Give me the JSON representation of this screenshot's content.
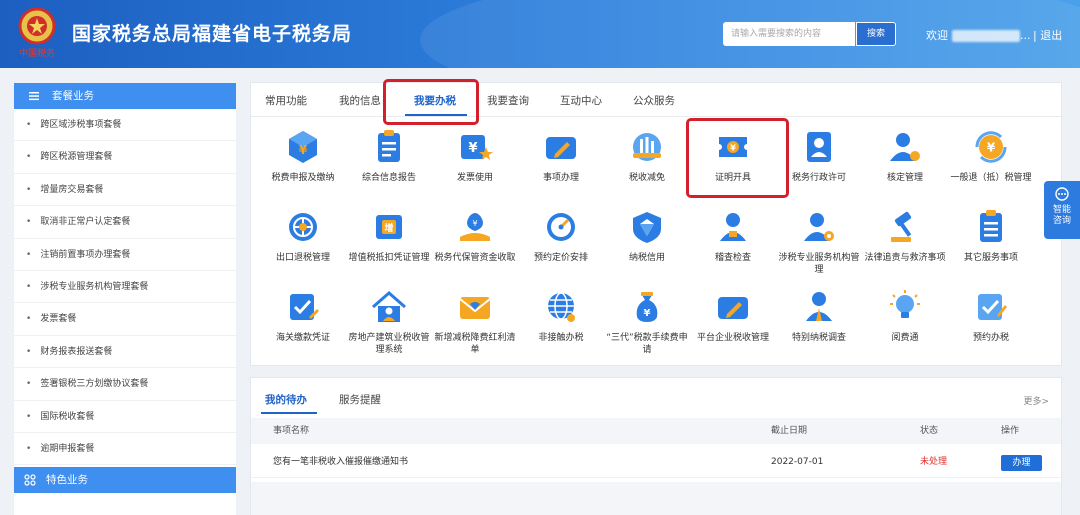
{
  "header": {
    "title": "国家税务总局福建省电子税务局",
    "emblem_text": "中国税务",
    "search_placeholder": "请输入需要搜索的内容",
    "search_button": "搜索",
    "welcome": "欢迎",
    "welcome_suffix": "...",
    "logout": "| 退出"
  },
  "sidebar": {
    "section1": "套餐业务",
    "items": [
      "跨区域涉税事项套餐",
      "跨区税源管理套餐",
      "增量房交易套餐",
      "取消非正常户认定套餐",
      "注销前置事项办理套餐",
      "涉税专业服务机构管理套餐",
      "发票套餐",
      "财务报表报送套餐",
      "签署银税三方划缴协议套餐",
      "国际税收套餐",
      "逾期申报套餐"
    ],
    "section2": "特色业务"
  },
  "tabs": [
    "常用功能",
    "我的信息",
    "我要办税",
    "我要查询",
    "互动中心",
    "公众服务"
  ],
  "active_tab": "我要办税",
  "services": [
    {
      "label": "税费申报及缴纳",
      "icon": "tax-filing-icon"
    },
    {
      "label": "综合信息报告",
      "icon": "report-icon"
    },
    {
      "label": "发票使用",
      "icon": "invoice-icon"
    },
    {
      "label": "事项办理",
      "icon": "handle-matter-icon"
    },
    {
      "label": "税收减免",
      "icon": "tax-relief-icon"
    },
    {
      "label": "证明开具",
      "icon": "certificate-icon"
    },
    {
      "label": "税务行政许可",
      "icon": "permit-icon"
    },
    {
      "label": "核定管理",
      "icon": "assessment-icon"
    },
    {
      "label": "一般退（抵）税管理",
      "icon": "refund-icon"
    },
    {
      "label": "出口退税管理",
      "icon": "export-refund-icon"
    },
    {
      "label": "增值税抵扣凭证管理",
      "icon": "vat-deduction-icon"
    },
    {
      "label": "税务代保管资金收取",
      "icon": "fund-custody-icon"
    },
    {
      "label": "预约定价安排",
      "icon": "pricing-icon"
    },
    {
      "label": "纳税信用",
      "icon": "credit-icon"
    },
    {
      "label": "稽查检查",
      "icon": "inspection-icon"
    },
    {
      "label": "涉税专业服务机构管理",
      "icon": "agency-icon"
    },
    {
      "label": "法律追责与救济事项",
      "icon": "legal-icon"
    },
    {
      "label": "其它服务事项",
      "icon": "other-services-icon"
    },
    {
      "label": "海关缴款凭证",
      "icon": "customs-icon"
    },
    {
      "label": "房地产建筑业税收管理系统",
      "icon": "real-estate-icon"
    },
    {
      "label": "新增减税降费红利清单",
      "icon": "tax-cut-icon"
    },
    {
      "label": "非接触办税",
      "icon": "contactless-icon"
    },
    {
      "label": "“三代”税款手续费申请",
      "icon": "fee-application-icon"
    },
    {
      "label": "平台企业税收管理",
      "icon": "platform-icon"
    },
    {
      "label": "特别纳税调查",
      "icon": "special-investigation-icon"
    },
    {
      "label": "阅费通",
      "icon": "bulb-icon"
    },
    {
      "label": "预约办税",
      "icon": "appointment-icon"
    }
  ],
  "help": {
    "line1": "智能",
    "line2": "咨询"
  },
  "todo": {
    "tabs": [
      "我的待办",
      "服务提醒"
    ],
    "more": "更多>",
    "columns": [
      "事项名称",
      "截止日期",
      "状态",
      "操作"
    ],
    "rows": [
      {
        "name": "您有一笔非税收入催报催缴通知书",
        "date": "2022-07-01",
        "status": "未处理",
        "action": "办理"
      }
    ]
  },
  "colors": {
    "header_blue": "#2f82df",
    "accent": "#1f64c8",
    "highlight_red": "#d4202b",
    "icon_blue": "#2b7de3",
    "icon_orange": "#f5a623"
  }
}
